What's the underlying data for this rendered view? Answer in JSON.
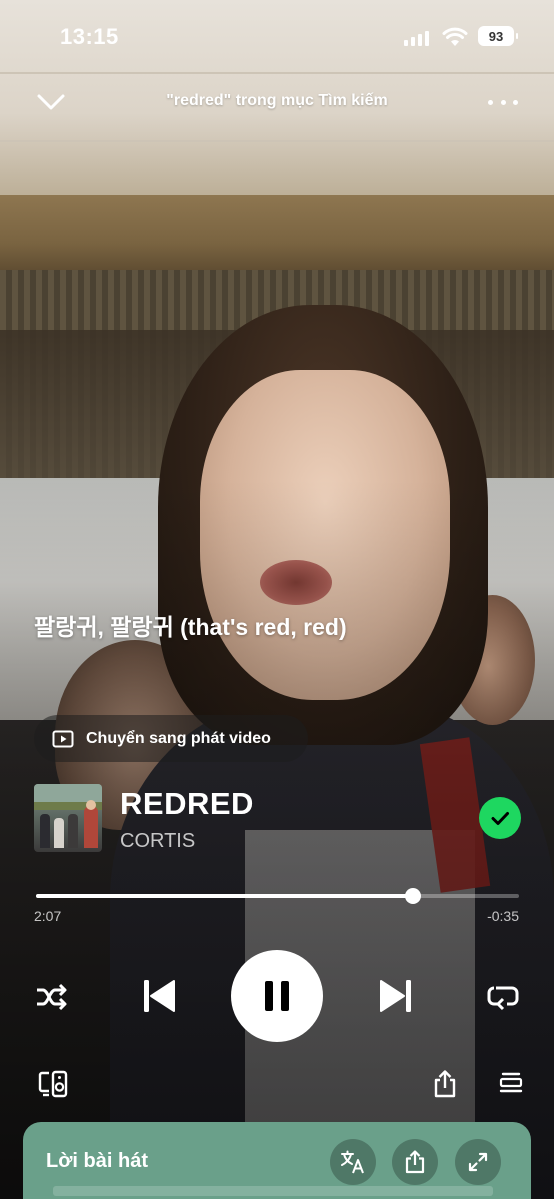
{
  "status_bar": {
    "time": "13:15",
    "battery": "93"
  },
  "header": {
    "context": "\"redred\" trong mục Tìm kiếm",
    "down_icon": "chevron-down-icon",
    "more_icon": "more-dots-icon"
  },
  "lyric_line": "팔랑귀, 팔랑귀 (that's red, red)",
  "video_switch": {
    "label": "Chuyển sang phát video",
    "icon": "play-box-icon"
  },
  "track": {
    "title": "REDRED",
    "artist": "CORTIS",
    "liked": true
  },
  "progress": {
    "elapsed": "2:07",
    "remaining": "-0:35",
    "fraction": 0.78
  },
  "controls": {
    "shuffle_icon": "shuffle-icon",
    "previous_icon": "skip-previous-icon",
    "play_state": "playing",
    "next_icon": "skip-next-icon",
    "repeat_icon": "repeat-icon"
  },
  "bottom_actions": {
    "devices_icon": "connect-device-icon",
    "share_icon": "share-icon",
    "queue_icon": "queue-icon"
  },
  "lyrics_card": {
    "title": "Lời bài hát",
    "translate_icon": "translate-icon",
    "share_icon": "share-icon",
    "expand_icon": "expand-icon"
  },
  "colors": {
    "accent_green": "#1ed760",
    "lyrics_card_bg": "#6aa08a"
  }
}
